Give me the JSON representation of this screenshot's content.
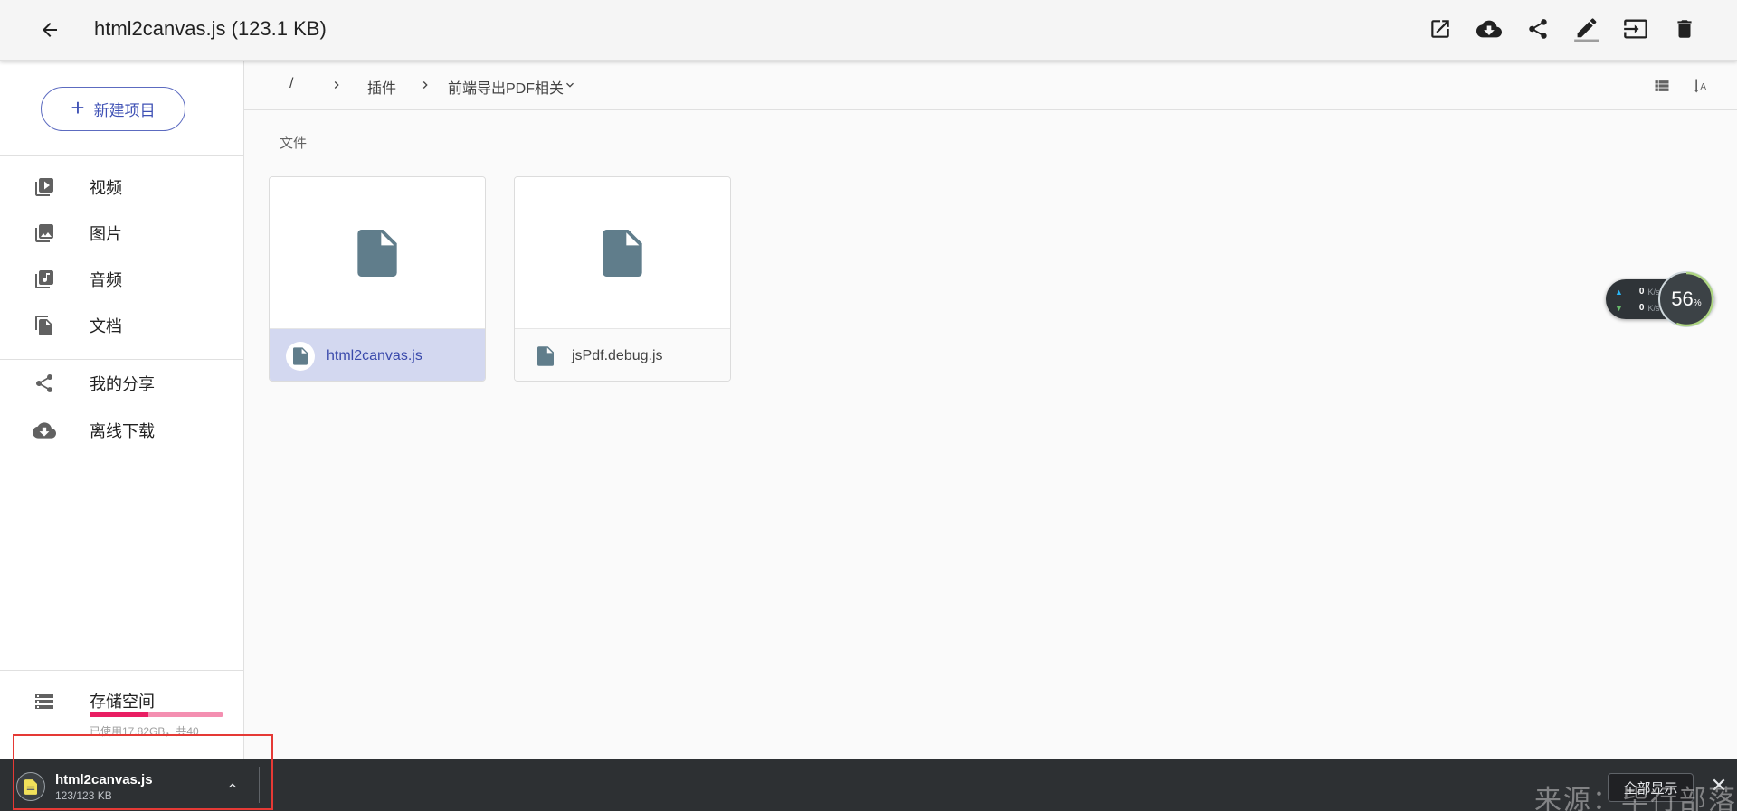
{
  "colors": {
    "accent": "#3f51b5",
    "file_icon": "#607d8b",
    "selected_bg": "#d3d8f0",
    "storage_used": "#e91e63",
    "storage_track": "#f48fb1",
    "download_bar": "#2d3033",
    "highlight": "#e53935"
  },
  "header": {
    "title": "html2canvas.js (123.1 KB)",
    "back_icon": "arrow-left-icon",
    "actions": [
      {
        "name": "open-external",
        "icon": "open-in-new-icon"
      },
      {
        "name": "download",
        "icon": "cloud-download-icon"
      },
      {
        "name": "share",
        "icon": "share-icon"
      },
      {
        "name": "rename",
        "icon": "pencil-icon"
      },
      {
        "name": "move",
        "icon": "move-to-icon"
      },
      {
        "name": "delete",
        "icon": "trash-icon"
      }
    ]
  },
  "sidebar": {
    "new_button": "新建项目",
    "items": [
      {
        "label": "视频",
        "icon": "video-library-icon"
      },
      {
        "label": "图片",
        "icon": "photo-library-icon"
      },
      {
        "label": "音频",
        "icon": "music-library-icon"
      },
      {
        "label": "文档",
        "icon": "documents-icon"
      },
      {
        "label": "我的分享",
        "icon": "share-icon"
      },
      {
        "label": "离线下载",
        "icon": "cloud-download-icon"
      }
    ],
    "storage": {
      "title": "存储空间",
      "subtitle": "已使用17.82GB，共40",
      "used_fraction": 0.445,
      "icon": "storage-icon"
    }
  },
  "breadcrumb": {
    "root": "/",
    "items": [
      "插件",
      "前端导出PDF相关"
    ],
    "tools": [
      {
        "name": "list-view",
        "icon": "list-view-icon"
      },
      {
        "name": "sort",
        "icon": "sort-alpha-icon"
      }
    ]
  },
  "content": {
    "section_label": "文件",
    "files": [
      {
        "name": "html2canvas.js",
        "selected": true,
        "icon": "file-icon"
      },
      {
        "name": "jsPdf.debug.js",
        "selected": false,
        "icon": "file-icon"
      }
    ]
  },
  "speed_widget": {
    "up": "0",
    "up_unit": "K/s",
    "down": "0",
    "down_unit": "K/s",
    "percent": "56",
    "percent_unit": "%"
  },
  "download_bar": {
    "file_name": "html2canvas.js",
    "file_size": "123/123 KB",
    "show_all": "全部显示",
    "close": "✕"
  },
  "watermark": "来源：毕行部落"
}
